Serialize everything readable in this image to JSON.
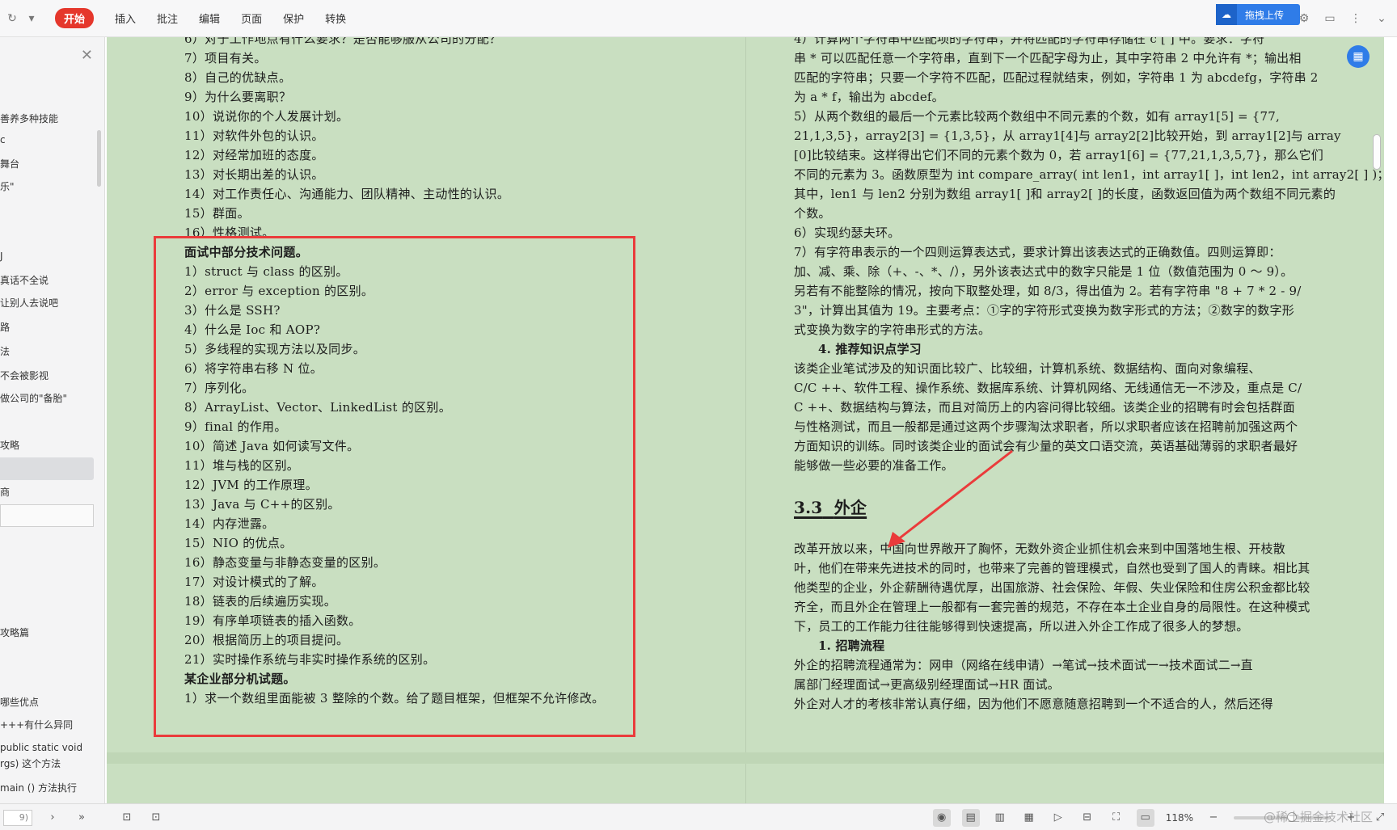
{
  "toolbar": {
    "menu": [
      "开始",
      "插入",
      "批注",
      "编辑",
      "页面",
      "保护",
      "转换"
    ],
    "upload_label": "拖拽上传"
  },
  "sidebar": {
    "items": [
      "善养多种技能",
      "c",
      "舞台",
      "乐\"",
      "J",
      "真话不全说",
      "让别人去说吧",
      "路",
      "法",
      "不会被影视",
      "做公司的\"备胎\"",
      "攻略",
      "商",
      "攻略篇",
      "哪些优点",
      "+++有什么异同",
      "public static void",
      "rgs) 这个方法",
      "main () 方法执行"
    ]
  },
  "left_page": {
    "lines": [
      "6）对于工作地点有什么要求？是否能够服从公司的分配？",
      "7）项目有关。",
      "8）自己的优缺点。",
      "9）为什么要离职？",
      "10）说说你的个人发展计划。",
      "11）对软件外包的认识。",
      "12）对经常加班的态度。",
      "13）对长期出差的认识。",
      "14）对工作责任心、沟通能力、团队精神、主动性的认识。",
      "15）群面。",
      "16）性格测试。"
    ],
    "box_heading": "面试中部分技术问题。",
    "box_lines": [
      "1）struct 与 class 的区别。",
      "2）error 与 exception 的区别。",
      "3）什么是 SSH?",
      "4）什么是 Ioc 和 AOP?",
      "5）多线程的实现方法以及同步。",
      "6）将字符串右移 N 位。",
      "7）序列化。",
      "8）ArrayList、Vector、LinkedList 的区别。",
      "9）final 的作用。",
      "10）简述 Java 如何读写文件。",
      "11）堆与栈的区别。",
      "12）JVM 的工作原理。",
      "13）Java 与 C++的区别。",
      "14）内存泄露。",
      "15）NIO 的优点。",
      "16）静态变量与非静态变量的区别。",
      "17）对设计模式的了解。",
      "18）链表的后续遍历实现。",
      "19）有序单项链表的插入函数。",
      "20）根据简历上的项目提问。",
      "21）实时操作系统与非实时操作系统的区别。"
    ],
    "box_heading2": "某企业部分机试题。",
    "box_last": "1）求一个数组里面能被 3 整除的个数。给了题目框架，但框架不允许修改。"
  },
  "right_page": {
    "lines": [
      "4）计算两个字符串中匹配项的字符串，并将匹配的字符串存储在 c [ ] 中。要求：字符",
      "串 * 可以匹配任意一个字符串，直到下一个匹配字母为止，其中字符串 2 中允许有 *；输出相",
      "匹配的字符串；只要一个字符不匹配，匹配过程就结束，例如，字符串 1 为 abcdefg，字符串 2",
      "为 a * f，输出为 abcdef。",
      "5）从两个数组的最后一个元素比较两个数组中不同元素的个数，如有 array1[5] = {77,",
      "21,1,3,5}，array2[3] = {1,3,5}，从 array1[4]与 array2[2]比较开始，到 array1[2]与 array",
      "[0]比较结束。这样得出它们不同的元素个数为 0，若 array1[6] = {77,21,1,3,5,7}，那么它们",
      "不同的元素为 3。函数原型为 int compare_array( int len1，int array1[ ]，int len2，int array2[ ] )；",
      "其中，len1 与 len2 分别为数组 array1[ ]和 array2[ ]的长度，函数返回值为两个数组不同元素的",
      "个数。",
      "6）实现约瑟夫环。",
      "7）有字符串表示的一个四则运算表达式，要求计算出该表达式的正确数值。四则运算即：",
      "加、减、乘、除（+、-、*、/），另外该表达式中的数字只能是 1 位（数值范围为 0 ～ 9）。",
      "另若有不能整除的情况，按向下取整处理，如 8/3，得出值为 2。若有字符串 \"8 + 7 * 2 - 9/",
      "3\"，计算出其值为 19。主要考点：①字的字符形式变换为数字形式的方法；②数字的数字形",
      "式变换为数字的字符串形式的方法。"
    ],
    "subhead": "4. 推荐知识点学习",
    "para2": [
      "该类企业笔试涉及的知识面比较广、比较细，计算机系统、数据结构、面向对象编程、",
      "C/C ++、软件工程、操作系统、数据库系统、计算机网络、无线通信无一不涉及，重点是 C/",
      "C ++、数据结构与算法，而且对简历上的内容问得比较细。该类企业的招聘有时会包括群面",
      "与性格测试，而且一般都是通过这两个步骤淘汰求职者，所以求职者应该在招聘前加强这两个",
      "方面知识的训练。同时该类企业的面试会有少量的英文口语交流，英语基础薄弱的求职者最好",
      "能够做一些必要的准备工作。"
    ],
    "section_num": "3.3",
    "section_title": "外企",
    "para3": [
      "改革开放以来，中国向世界敞开了胸怀，无数外资企业抓住机会来到中国落地生根、开枝散",
      "叶，他们在带来先进技术的同时，也带来了完善的管理模式，自然也受到了国人的青睐。相比其",
      "他类型的企业，外企薪酬待遇优厚，出国旅游、社会保险、年假、失业保险和住房公积金都比较",
      "齐全，而且外企在管理上一般都有一套完善的规范，不存在本土企业自身的局限性。在这种模式",
      "下，员工的工作能力往往能够得到快速提高，所以进入外企工作成了很多人的梦想。"
    ],
    "subhead2": "1. 招聘流程",
    "para4": [
      "外企的招聘流程通常为：网申（网络在线申请）→笔试→技术面试一→技术面试二→直",
      "属部门经理面试→更高级别经理面试→HR 面试。",
      "外企对人才的考核非常认真仔细，因为他们不愿意随意招聘到一个不适合的人，然后还得"
    ]
  },
  "statusbar": {
    "page_input": "9)",
    "zoom": "118%",
    "watermark": "@稀土掘金技术社区"
  },
  "colors": {
    "accent": "#e5372c",
    "page_bg": "#c9dfc1",
    "highlight_box": "#ea3b3b",
    "brand_blue": "#2f7ce8"
  }
}
